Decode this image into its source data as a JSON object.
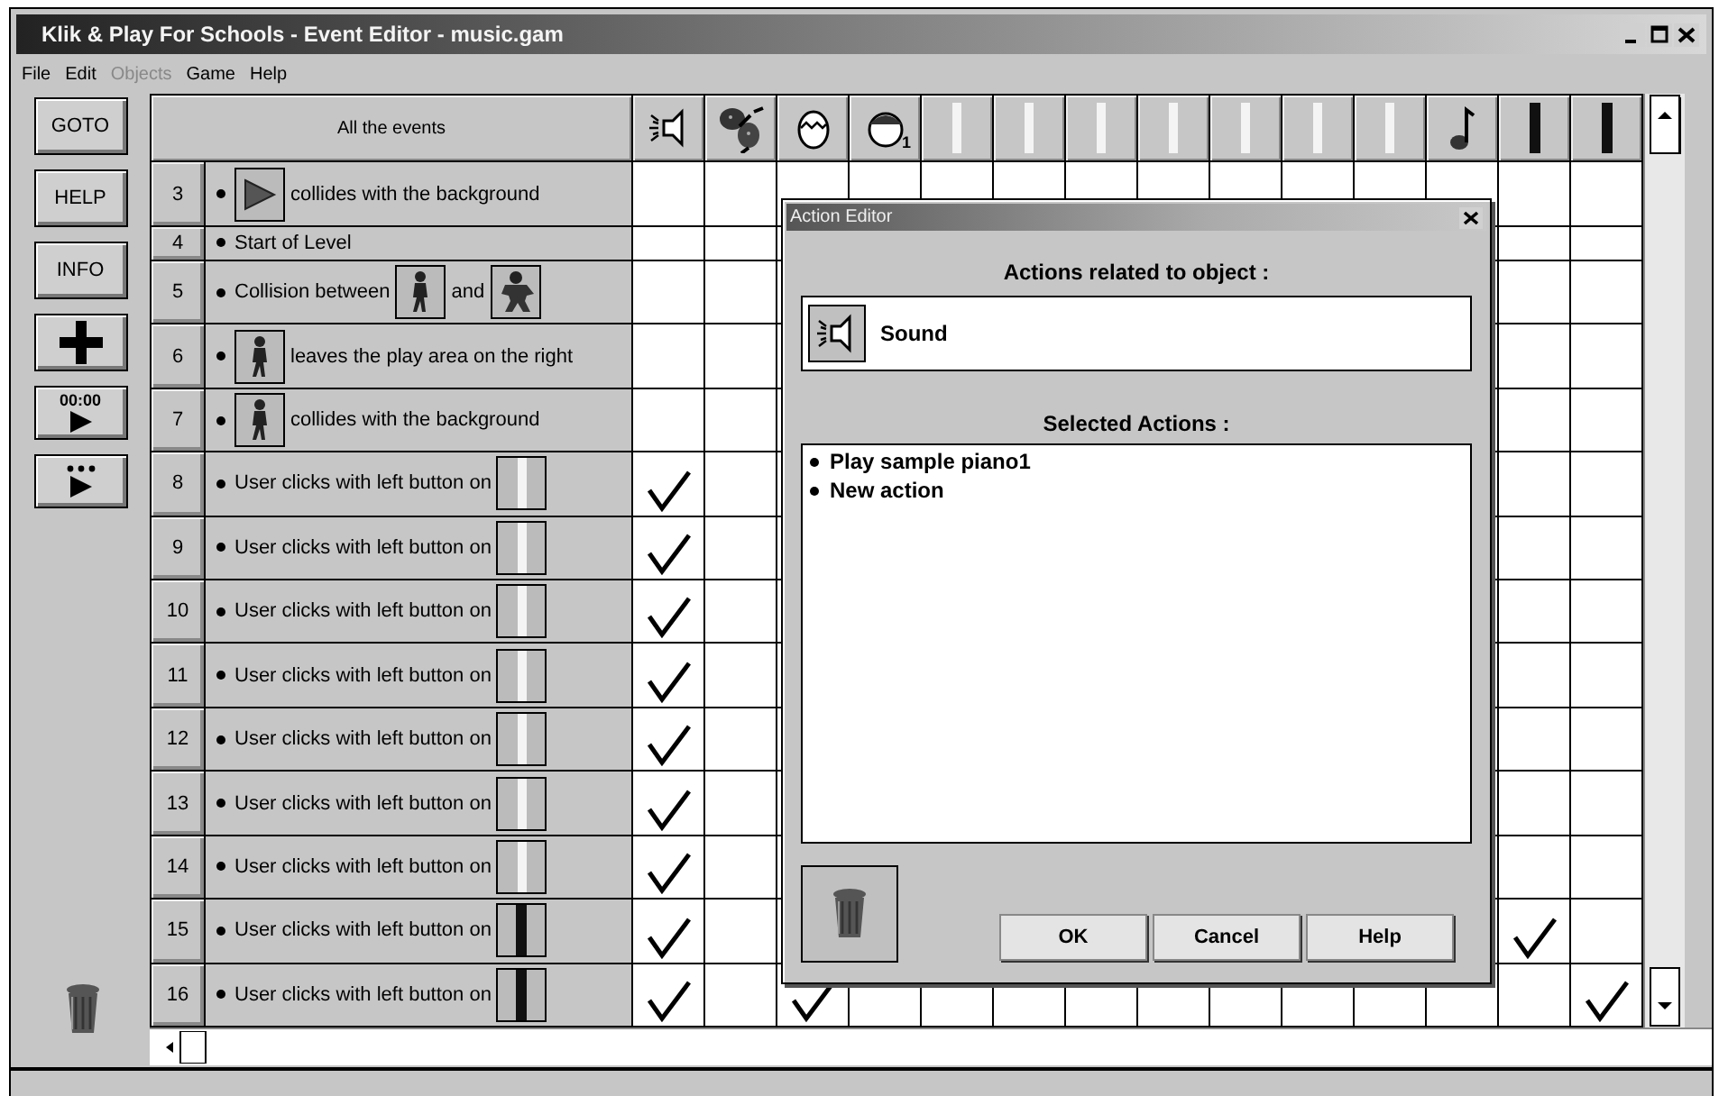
{
  "window": {
    "title": "Klik & Play For Schools - Event Editor - music.gam"
  },
  "menu": [
    {
      "label": "File",
      "disabled": false
    },
    {
      "label": "Edit",
      "disabled": false
    },
    {
      "label": "Objects",
      "disabled": true
    },
    {
      "label": "Game",
      "disabled": false
    },
    {
      "label": "Help",
      "disabled": false
    }
  ],
  "toolbar": [
    {
      "kind": "text",
      "label": "GOTO"
    },
    {
      "kind": "text",
      "label": "HELP"
    },
    {
      "kind": "text",
      "label": "INFO"
    },
    {
      "kind": "plus"
    },
    {
      "kind": "timer",
      "label": "00:00"
    },
    {
      "kind": "dots"
    }
  ],
  "header": {
    "label": "All the events",
    "columns": [
      {
        "kind": "speaker"
      },
      {
        "kind": "maracas"
      },
      {
        "kind": "egg"
      },
      {
        "kind": "face",
        "badge": "1"
      },
      {
        "kind": "key"
      },
      {
        "kind": "key"
      },
      {
        "kind": "key"
      },
      {
        "kind": "key"
      },
      {
        "kind": "key"
      },
      {
        "kind": "key"
      },
      {
        "kind": "key"
      },
      {
        "kind": "note"
      },
      {
        "kind": "bar"
      },
      {
        "kind": "bar"
      }
    ]
  },
  "rows": [
    {
      "number": "3",
      "parts": [
        {
          "kind": "triangle"
        },
        {
          "kind": "text",
          "text": "collides with the background"
        }
      ],
      "marks": [
        false,
        false,
        false,
        false,
        false,
        false,
        false,
        false,
        false,
        false,
        false,
        false,
        false,
        false
      ]
    },
    {
      "number": "4",
      "parts": [
        {
          "kind": "text",
          "text": "Start of Level"
        }
      ],
      "marks": [
        false,
        false,
        false,
        false,
        false,
        false,
        false,
        false,
        false,
        false,
        false,
        false,
        false,
        false
      ]
    },
    {
      "number": "5",
      "parts": [
        {
          "kind": "text",
          "text": "Collision between"
        },
        {
          "kind": "walker"
        },
        {
          "kind": "text",
          "text": "and"
        },
        {
          "kind": "monster"
        }
      ],
      "marks": [
        false,
        false,
        false,
        false,
        false,
        false,
        false,
        false,
        false,
        false,
        false,
        false,
        false,
        false
      ]
    },
    {
      "number": "6",
      "parts": [
        {
          "kind": "walker"
        },
        {
          "kind": "text",
          "text": "leaves the play area on the right"
        }
      ],
      "marks": [
        false,
        false,
        false,
        false,
        false,
        false,
        false,
        false,
        false,
        false,
        false,
        false,
        false,
        false
      ]
    },
    {
      "number": "7",
      "parts": [
        {
          "kind": "walker"
        },
        {
          "kind": "text",
          "text": "collides with the background"
        }
      ],
      "marks": [
        false,
        false,
        false,
        false,
        false,
        false,
        false,
        false,
        false,
        false,
        false,
        false,
        false,
        false
      ]
    },
    {
      "number": "8",
      "parts": [
        {
          "kind": "text",
          "text": "User clicks with left button on"
        },
        {
          "kind": "key"
        }
      ],
      "marks": [
        true,
        false,
        false,
        false,
        false,
        false,
        false,
        false,
        false,
        false,
        false,
        false,
        false,
        false
      ]
    },
    {
      "number": "9",
      "parts": [
        {
          "kind": "text",
          "text": "User clicks with left button on"
        },
        {
          "kind": "key"
        }
      ],
      "marks": [
        true,
        false,
        false,
        false,
        false,
        false,
        false,
        false,
        false,
        false,
        false,
        false,
        false,
        false
      ]
    },
    {
      "number": "10",
      "parts": [
        {
          "kind": "text",
          "text": "User clicks with left button on"
        },
        {
          "kind": "key"
        }
      ],
      "marks": [
        true,
        false,
        false,
        false,
        false,
        false,
        false,
        false,
        false,
        false,
        false,
        false,
        false,
        false
      ]
    },
    {
      "number": "11",
      "parts": [
        {
          "kind": "text",
          "text": "User clicks with left button on"
        },
        {
          "kind": "key"
        }
      ],
      "marks": [
        true,
        false,
        false,
        false,
        false,
        false,
        false,
        false,
        false,
        false,
        false,
        false,
        false,
        false
      ]
    },
    {
      "number": "12",
      "parts": [
        {
          "kind": "text",
          "text": "User clicks with left button on"
        },
        {
          "kind": "key"
        }
      ],
      "marks": [
        true,
        false,
        false,
        false,
        false,
        false,
        false,
        false,
        false,
        false,
        false,
        false,
        false,
        false
      ]
    },
    {
      "number": "13",
      "parts": [
        {
          "kind": "text",
          "text": "User clicks with left button on"
        },
        {
          "kind": "key"
        }
      ],
      "marks": [
        true,
        false,
        false,
        false,
        false,
        false,
        false,
        false,
        false,
        false,
        false,
        false,
        false,
        false
      ]
    },
    {
      "number": "14",
      "parts": [
        {
          "kind": "text",
          "text": "User clicks with left button on"
        },
        {
          "kind": "key"
        }
      ],
      "marks": [
        true,
        false,
        false,
        false,
        false,
        false,
        false,
        false,
        false,
        false,
        false,
        false,
        false,
        false
      ]
    },
    {
      "number": "15",
      "parts": [
        {
          "kind": "text",
          "text": "User clicks with left button on"
        },
        {
          "kind": "bar"
        }
      ],
      "marks": [
        true,
        false,
        false,
        false,
        false,
        false,
        false,
        false,
        false,
        false,
        false,
        false,
        true,
        false
      ]
    },
    {
      "number": "16",
      "parts": [
        {
          "kind": "text",
          "text": "User clicks with left button on"
        },
        {
          "kind": "bar"
        }
      ],
      "marks": [
        true,
        false,
        true,
        false,
        false,
        false,
        false,
        false,
        false,
        false,
        false,
        false,
        false,
        true
      ]
    }
  ],
  "dialog": {
    "title": "Action Editor",
    "object_label": "Actions related to object :",
    "object": {
      "kind": "speaker",
      "name": "Sound"
    },
    "actions_label": "Selected Actions :",
    "actions": [
      "Play sample piano1",
      "New action"
    ],
    "buttons": [
      "OK",
      "Cancel",
      "Help"
    ]
  }
}
